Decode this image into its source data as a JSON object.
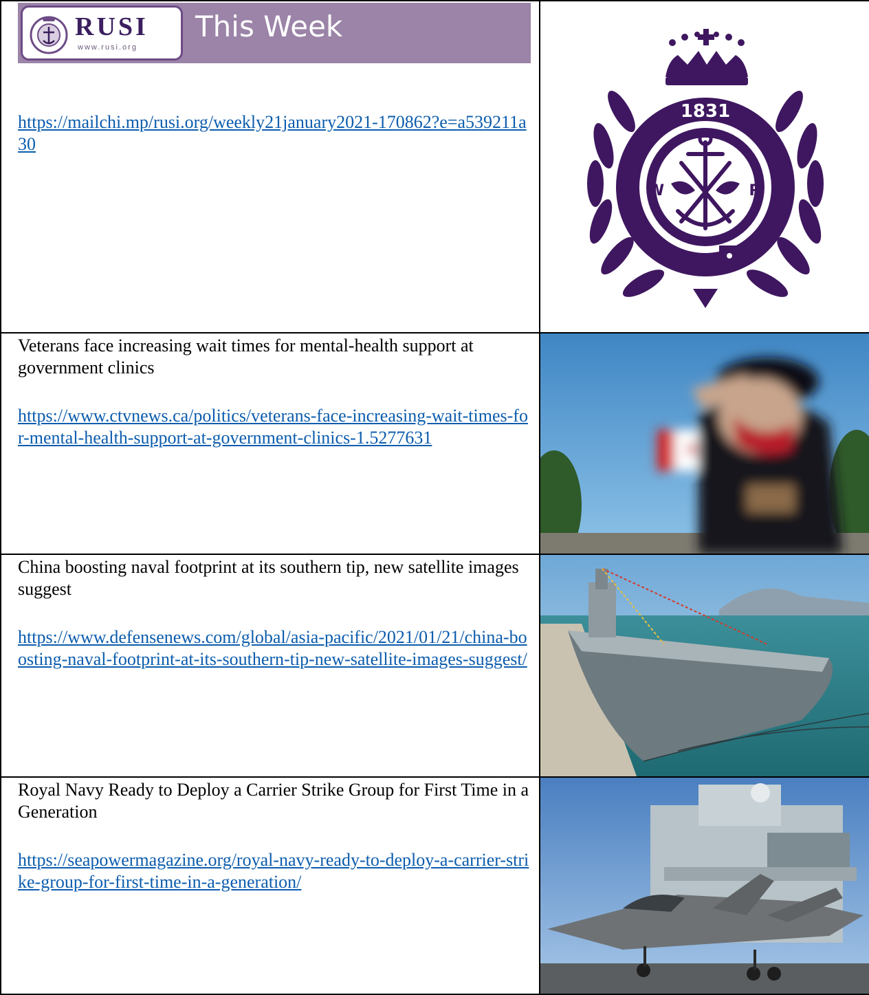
{
  "banner": {
    "logo_text": "RUSI",
    "logo_url": "www.rusi.org",
    "title": "This Week"
  },
  "rows": [
    {
      "headline": "",
      "link": "https://mailchi.mp/rusi.org/weekly21january2021-170862?e=a539211a30",
      "image_icon": "rusi-crest-icon",
      "crest_year": "1831",
      "crest_left": "W",
      "crest_right": "R"
    },
    {
      "headline": "Veterans face increasing wait times for mental-health support at government clinics",
      "link": "https://www.ctvnews.ca/politics/veterans-face-increasing-wait-times-for-mental-health-support-at-government-clinics-1.5277631",
      "image_icon": "saluting-veteran-photo"
    },
    {
      "headline": "China boosting naval footprint at its southern tip, new satellite images suggest",
      "link": "https://www.defensenews.com/global/asia-pacific/2021/01/21/china-boosting-naval-footprint-at-its-southern-tip-new-satellite-images-suggest/",
      "image_icon": "aircraft-carrier-photo"
    },
    {
      "headline": "Royal Navy Ready to Deploy a Carrier Strike Group for First Time in a Generation",
      "link": "https://seapowermagazine.org/royal-navy-ready-to-deploy-a-carrier-strike-group-for-first-time-in-a-generation/",
      "image_icon": "fighter-jet-carrier-photo"
    }
  ],
  "colors": {
    "banner_bg": "#9b84a8",
    "crest_purple": "#3f1760",
    "link_blue": "#0b5cad"
  }
}
